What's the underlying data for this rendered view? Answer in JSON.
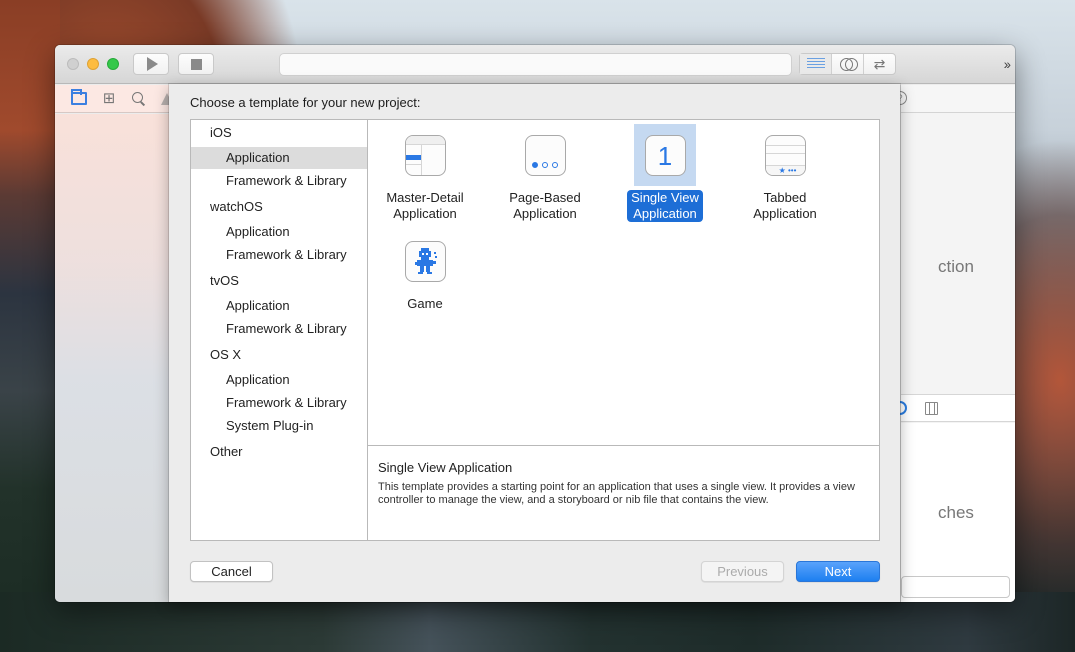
{
  "toolbar": {
    "run_icon": "play-icon",
    "stop_icon": "stop-icon",
    "activity_text": "",
    "editor_modes": [
      {
        "name": "standard-editor",
        "icon": "lines-icon",
        "active": true
      },
      {
        "name": "assistant-editor",
        "icon": "rings-icon",
        "active": false
      },
      {
        "name": "version-editor",
        "icon": "arrows-icon",
        "active": false
      }
    ],
    "overflow_label": "››"
  },
  "navigator_icons": [
    "folder-icon",
    "hierarchy-icon",
    "search-icon",
    "warning-icon"
  ],
  "sheet": {
    "title": "Choose a template for your new project:",
    "sidebar": [
      {
        "label": "iOS",
        "type": "group",
        "selected": false
      },
      {
        "label": "Application",
        "type": "sub",
        "selected": true
      },
      {
        "label": "Framework & Library",
        "type": "sub",
        "selected": false
      },
      {
        "label": "watchOS",
        "type": "group",
        "selected": false
      },
      {
        "label": "Application",
        "type": "sub",
        "selected": false
      },
      {
        "label": "Framework & Library",
        "type": "sub",
        "selected": false
      },
      {
        "label": "tvOS",
        "type": "group",
        "selected": false
      },
      {
        "label": "Application",
        "type": "sub",
        "selected": false
      },
      {
        "label": "Framework & Library",
        "type": "sub",
        "selected": false
      },
      {
        "label": "OS X",
        "type": "group",
        "selected": false
      },
      {
        "label": "Application",
        "type": "sub",
        "selected": false
      },
      {
        "label": "Framework & Library",
        "type": "sub",
        "selected": false
      },
      {
        "label": "System Plug-in",
        "type": "sub",
        "selected": false
      },
      {
        "label": "Other",
        "type": "group",
        "selected": false
      }
    ],
    "templates": [
      {
        "label_line1": "Master-Detail",
        "label_line2": "Application",
        "icon": "master-detail-icon",
        "selected": false
      },
      {
        "label_line1": "Page-Based",
        "label_line2": "Application",
        "icon": "page-based-icon",
        "selected": false
      },
      {
        "label_line1": "Single View",
        "label_line2": "Application",
        "icon": "single-view-icon",
        "icon_text": "1",
        "selected": true
      },
      {
        "label_line1": "Tabbed",
        "label_line2": "Application",
        "icon": "tabbed-icon",
        "icon_text": "★ •••",
        "selected": false
      },
      {
        "label_line1": "Game",
        "label_line2": "",
        "icon": "game-icon",
        "selected": false
      }
    ],
    "description": {
      "title": "Single View Application",
      "body": "This template provides a starting point for an application that uses a single view. It provides a view controller to manage the view, and a storyboard or nib file that contains the view."
    },
    "buttons": {
      "cancel": "Cancel",
      "previous": "Previous",
      "next": "Next"
    }
  },
  "inspector": {
    "partial_text_1": "ction",
    "partial_text_2": "ches",
    "help_icon_glyph": "?"
  },
  "colors": {
    "accent": "#1d6ed6",
    "selection_highlight": "#c5d9f1",
    "next_button": "#1d7ff0"
  }
}
